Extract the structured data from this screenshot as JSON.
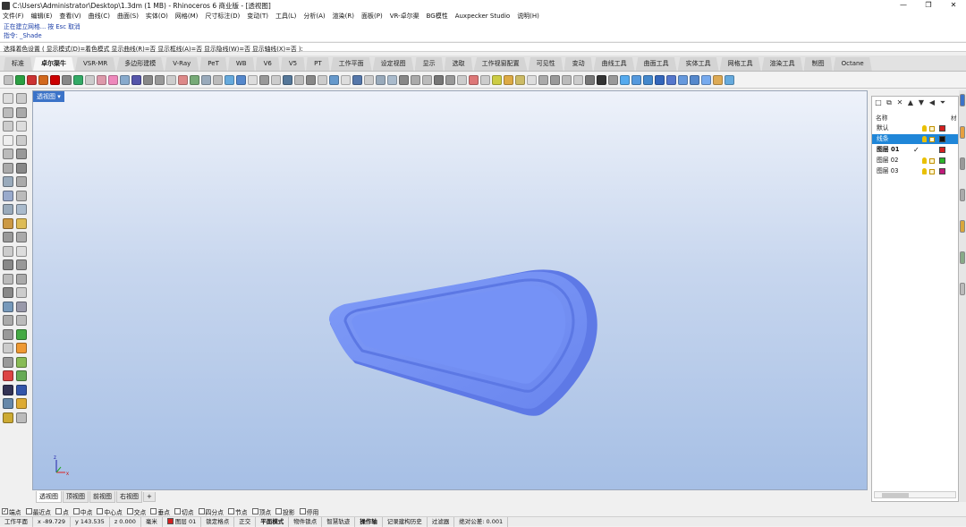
{
  "titlebar": {
    "title": "C:\\Users\\Administrator\\Desktop\\1.3dm (1 MB) - Rhinoceros 6 商业版 - [透视图]",
    "minimize": "—",
    "maximize": "❐",
    "close": "✕"
  },
  "menu": [
    "文件(F)",
    "编辑(E)",
    "查看(V)",
    "曲线(C)",
    "曲面(S)",
    "实体(O)",
    "网格(M)",
    "尺寸标注(D)",
    "变动(T)",
    "工具(L)",
    "分析(A)",
    "渲染(R)",
    "面板(P)",
    "VR-卓尔渠",
    "BG模性",
    "Auxpecker Studio",
    "说明(H)"
  ],
  "command_history": {
    "line1": "正在建立网格... 按 Esc 取消",
    "line2": "指令: _Shade"
  },
  "command_prompt": {
    "text": "选择着色设置 ( 显示模式(D)=着色模式  显示曲线(R)=否  显示框线(A)=否  显示隐线(W)=否  显示轴线(X)=否 ):"
  },
  "tabs": [
    "标准",
    "卓尔渠牛",
    "VSR-MR",
    "多边形建模",
    "V-Ray",
    "PeT",
    "WB",
    "V6",
    "V5",
    "PT",
    "工作平面",
    "设定视图",
    "显示",
    "选取",
    "工作视窗配置",
    "可见性",
    "变动",
    "曲线工具",
    "曲面工具",
    "实体工具",
    "网格工具",
    "渲染工具",
    "制图",
    "Octane"
  ],
  "active_tab_index": 1,
  "viewport": {
    "title": "透视图",
    "object_color": "#6f8df5",
    "axis_x_label": "x",
    "axis_z_label": "z"
  },
  "viewport_tabs": [
    "透视图",
    "顶视图",
    "前视图",
    "右视图",
    "+"
  ],
  "osnaps": [
    {
      "label": "端点",
      "checked": true
    },
    {
      "label": "最近点",
      "checked": false
    },
    {
      "label": "点",
      "checked": false
    },
    {
      "label": "中点",
      "checked": false
    },
    {
      "label": "中心点",
      "checked": false
    },
    {
      "label": "交点",
      "checked": false
    },
    {
      "label": "垂点",
      "checked": false
    },
    {
      "label": "切点",
      "checked": false
    },
    {
      "label": "四分点",
      "checked": false
    },
    {
      "label": "节点",
      "checked": false
    },
    {
      "label": "顶点",
      "checked": false
    },
    {
      "label": "投影",
      "checked": false
    },
    {
      "label": "停用",
      "checked": false
    }
  ],
  "status": {
    "cplane": "工作平面",
    "x": "x -89.729",
    "y": "y 143.535",
    "z": "z 0.000",
    "units": "毫米",
    "layer": "图层 01",
    "items": [
      "锁定格点",
      "正交",
      "平面模式",
      "物件锁点",
      "智慧轨迹",
      "操作轴",
      "记录建构历史",
      "过滤器"
    ],
    "tolerance": "绝对公差: 0.001"
  },
  "layers": {
    "col_name": "名称",
    "col_material": "材",
    "rows": [
      {
        "name": "默认",
        "color": "#d42020",
        "selected": false,
        "current": false
      },
      {
        "name": "线条",
        "color": "#111111",
        "selected": true,
        "current": false
      },
      {
        "name": "图层 01",
        "color": "#d42020",
        "selected": false,
        "current": true
      },
      {
        "name": "图层 02",
        "color": "#2bb52b",
        "selected": false,
        "current": false
      },
      {
        "name": "图层 03",
        "color": "#c01a7a",
        "selected": false,
        "current": false
      }
    ]
  }
}
